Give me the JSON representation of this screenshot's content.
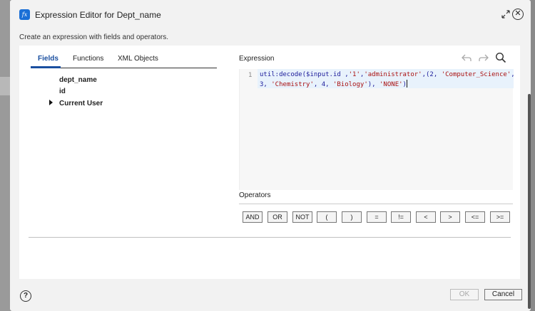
{
  "dialog": {
    "title": "Expression Editor for Dept_name",
    "subtitle": "Create an expression with fields and operators.",
    "title_icon": "fx"
  },
  "tabs": [
    {
      "label": "Fields"
    },
    {
      "label": "Functions"
    },
    {
      "label": "XML Objects"
    }
  ],
  "fields": [
    {
      "label": "dept_name"
    },
    {
      "label": "id"
    },
    {
      "label": "Current User"
    }
  ],
  "expression": {
    "label": "Expression",
    "line_number": "1",
    "line1_fn": "util:decode($input.id ,",
    "line1_s1": "'1'",
    "line1_c1": ",",
    "line1_s2": "'administrator'",
    "line1_c2": ",(2, ",
    "line1_s3": "'Computer_Science'",
    "line1_c3": ",",
    "line2_c1": "3, ",
    "line2_s1": "'Chemistry'",
    "line2_c2": ", 4, ",
    "line2_s2": "'Biology'",
    "line2_c3": "), ",
    "line2_s3": "'NONE'",
    "line2_c4": ")"
  },
  "operators": {
    "label": "Operators",
    "buttons": [
      "AND",
      "OR",
      "NOT",
      "(",
      ")",
      "=",
      "!=",
      "<",
      ">",
      "<=",
      ">="
    ]
  },
  "footer": {
    "ok_label": "OK",
    "cancel_label": "Cancel",
    "help_glyph": "?"
  }
}
